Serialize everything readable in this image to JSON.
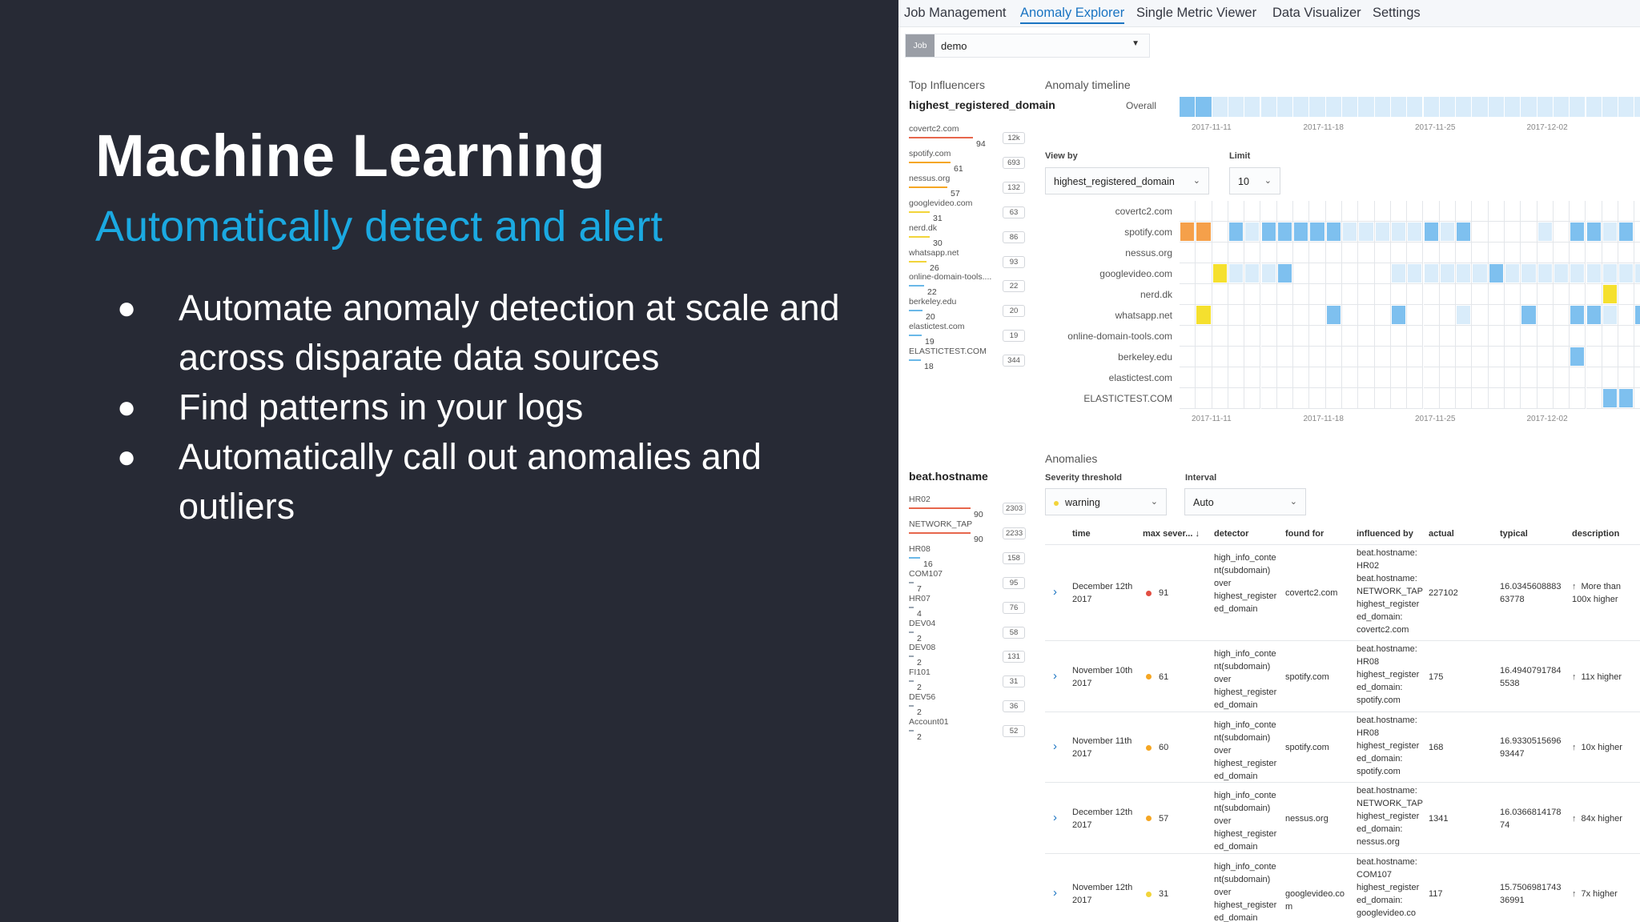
{
  "slide": {
    "title": "Machine Learning",
    "subtitle": "Automatically detect and alert",
    "bullets": [
      "Automate anomaly detection at scale and across disparate data sources",
      "Find patterns in your logs",
      "Automatically call out anomalies and outliers"
    ]
  },
  "nav": {
    "tabs": [
      "Job Management",
      "Anomaly Explorer",
      "Single Metric Viewer",
      "Data Visualizer",
      "Settings"
    ],
    "active": "Anomaly Explorer"
  },
  "job": {
    "tag": "Job",
    "value": "demo"
  },
  "influencers": {
    "title": "Top Influencers",
    "domain_field": "highest_registered_domain",
    "domain_items": [
      {
        "name": "covertc2.com",
        "score": "94",
        "total": "12k",
        "color": "#e7664c",
        "score_fraction": 0.94
      },
      {
        "name": "spotify.com",
        "score": "61",
        "total": "693",
        "color": "#f5a623",
        "score_fraction": 0.61
      },
      {
        "name": "nessus.org",
        "score": "57",
        "total": "132",
        "color": "#f5a623",
        "score_fraction": 0.57
      },
      {
        "name": "googlevideo.com",
        "score": "31",
        "total": "63",
        "color": "#f2d43a",
        "score_fraction": 0.31
      },
      {
        "name": "nerd.dk",
        "score": "30",
        "total": "86",
        "color": "#f2d43a",
        "score_fraction": 0.3
      },
      {
        "name": "whatsapp.net",
        "score": "26",
        "total": "93",
        "color": "#f2d43a",
        "score_fraction": 0.26
      },
      {
        "name": "online-domain-tools....",
        "score": "22",
        "total": "22",
        "color": "#6ab8e8",
        "score_fraction": 0.22
      },
      {
        "name": "berkeley.edu",
        "score": "20",
        "total": "20",
        "color": "#6ab8e8",
        "score_fraction": 0.2
      },
      {
        "name": "elastictest.com",
        "score": "19",
        "total": "19",
        "color": "#6ab8e8",
        "score_fraction": 0.19
      },
      {
        "name": "ELASTICTEST.COM",
        "score": "18",
        "total": "344",
        "color": "#6ab8e8",
        "score_fraction": 0.18
      }
    ],
    "host_field": "beat.hostname",
    "host_items": [
      {
        "name": "HR02",
        "score": "90",
        "total": "2303",
        "color": "#e7664c",
        "score_fraction": 0.9
      },
      {
        "name": "NETWORK_TAP",
        "score": "90",
        "total": "2233",
        "color": "#e7664c",
        "score_fraction": 0.9
      },
      {
        "name": "HR08",
        "score": "16",
        "total": "158",
        "color": "#6ab8e8",
        "score_fraction": 0.16
      },
      {
        "name": "COM107",
        "score": "7",
        "total": "95",
        "color": "#9aa5b1",
        "score_fraction": 0.07
      },
      {
        "name": "HR07",
        "score": "4",
        "total": "76",
        "color": "#9aa5b1",
        "score_fraction": 0.04
      },
      {
        "name": "DEV04",
        "score": "2",
        "total": "58",
        "color": "#9aa5b1",
        "score_fraction": 0.02
      },
      {
        "name": "DEV08",
        "score": "2",
        "total": "131",
        "color": "#9aa5b1",
        "score_fraction": 0.02
      },
      {
        "name": "FI101",
        "score": "2",
        "total": "31",
        "color": "#9aa5b1",
        "score_fraction": 0.02
      },
      {
        "name": "DEV56",
        "score": "2",
        "total": "36",
        "color": "#9aa5b1",
        "score_fraction": 0.02
      },
      {
        "name": "Account01",
        "score": "2",
        "total": "52",
        "color": "#9aa5b1",
        "score_fraction": 0.02
      }
    ]
  },
  "timeline": {
    "title": "Anomaly timeline",
    "overall_label": "Overall",
    "dates": [
      "2017-11-11",
      "2017-11-18",
      "2017-11-25",
      "2017-12-02"
    ],
    "overall_cells": [
      "b",
      "b",
      "l",
      "l",
      "l",
      "l",
      "l",
      "l",
      "l",
      "l",
      "l",
      "l",
      "l",
      "l",
      "l",
      "l",
      "l",
      "l",
      "l",
      "l",
      "l",
      "l",
      "l",
      "l",
      "l",
      "l",
      "l",
      "l",
      "l",
      "l",
      "l",
      "l"
    ],
    "view_by_label": "View by",
    "view_by_value": "highest_registered_domain",
    "limit_label": "Limit",
    "limit_value": "10",
    "swimlanes": [
      {
        "label": "covertc2.com",
        "cells": {}
      },
      {
        "label": "spotify.com",
        "cells": {
          "0": "o",
          "1": "o",
          "3": "b",
          "4": "l",
          "5": "b",
          "6": "b",
          "7": "b",
          "8": "b",
          "9": "b",
          "10": "l",
          "11": "l",
          "12": "l",
          "13": "l",
          "14": "l",
          "15": "b",
          "16": "l",
          "17": "b",
          "22": "l",
          "24": "b",
          "25": "b",
          "26": "l",
          "27": "b",
          "29": "l"
        }
      },
      {
        "label": "nessus.org",
        "cells": {}
      },
      {
        "label": "googlevideo.com",
        "cells": {
          "2": "y",
          "3": "l",
          "4": "l",
          "5": "l",
          "6": "b",
          "13": "l",
          "14": "l",
          "15": "l",
          "16": "l",
          "17": "l",
          "18": "l",
          "19": "b",
          "20": "l",
          "21": "l",
          "22": "l",
          "23": "l",
          "24": "l",
          "25": "l",
          "26": "l",
          "27": "l",
          "28": "l",
          "29": "l",
          "30": "l",
          "31": "l"
        }
      },
      {
        "label": "nerd.dk",
        "cells": {
          "26": "y"
        }
      },
      {
        "label": "whatsapp.net",
        "cells": {
          "1": "y",
          "9": "b",
          "13": "b",
          "17": "l",
          "21": "b",
          "24": "b",
          "25": "b",
          "26": "l",
          "28": "b",
          "29": "b",
          "31": "l"
        }
      },
      {
        "label": "online-domain-tools.com",
        "cells": {}
      },
      {
        "label": "berkeley.edu",
        "cells": {
          "24": "b"
        }
      },
      {
        "label": "elastictest.com",
        "cells": {}
      },
      {
        "label": "ELASTICTEST.COM",
        "cells": {
          "26": "b",
          "27": "b",
          "31": "b"
        }
      }
    ]
  },
  "anomalies": {
    "title": "Anomalies",
    "severity_label": "Severity threshold",
    "severity_value": "warning",
    "interval_label": "Interval",
    "interval_value": "Auto",
    "columns": [
      "time",
      "max sever...",
      "detector",
      "found for",
      "influenced by",
      "actual",
      "typical",
      "description"
    ],
    "sort_icon": "↓",
    "rows": [
      {
        "time": "December 12th 2017",
        "score": "91",
        "score_color": "#e24e42",
        "detector": "high_info_conte nt(subdomain) over highest_register ed_domain",
        "found_for": "covertc2.com",
        "influenced_by": "beat.hostname: HR02 beat.hostname: NETWORK_TAP highest_register ed_domain: covertc2.com",
        "actual": "227102",
        "typical": "16.0345608883 63778",
        "description": "More than 100x higher"
      },
      {
        "time": "November 10th 2017",
        "score": "61",
        "score_color": "#f5a623",
        "detector": "high_info_conte nt(subdomain) over highest_register ed_domain",
        "found_for": "spotify.com",
        "influenced_by": "beat.hostname: HR08 highest_register ed_domain: spotify.com",
        "actual": "175",
        "typical": "16.4940791784 5538",
        "description": "11x higher"
      },
      {
        "time": "November 11th 2017",
        "score": "60",
        "score_color": "#f5a623",
        "detector": "high_info_conte nt(subdomain) over highest_register ed_domain",
        "found_for": "spotify.com",
        "influenced_by": "beat.hostname: HR08 highest_register ed_domain: spotify.com",
        "actual": "168",
        "typical": "16.9330515696 93447",
        "description": "10x higher"
      },
      {
        "time": "December 12th 2017",
        "score": "57",
        "score_color": "#f5a623",
        "detector": "high_info_conte nt(subdomain) over highest_register ed_domain",
        "found_for": "nessus.org",
        "influenced_by": "beat.hostname: NETWORK_TAP highest_register ed_domain: nessus.org",
        "actual": "1341",
        "typical": "16.0366814178 74",
        "description": "84x higher"
      },
      {
        "time": "November 12th 2017",
        "score": "31",
        "score_color": "#f2d43a",
        "detector": "high_info_conte nt(subdomain) over highest_register ed_domain",
        "found_for": "googlevideo.co m",
        "influenced_by": "beat.hostname: COM107 highest_register ed_domain: googlevideo.co",
        "actual": "117",
        "typical": "15.7506981743 36991",
        "description": "7x higher"
      }
    ]
  },
  "colors": {
    "blue_cell": "#7ec0ef",
    "light_cell": "#d9ecfa",
    "orange_cell": "#f5a04a",
    "yellow_cell": "#f5e02e",
    "accent": "#1a74c2"
  }
}
